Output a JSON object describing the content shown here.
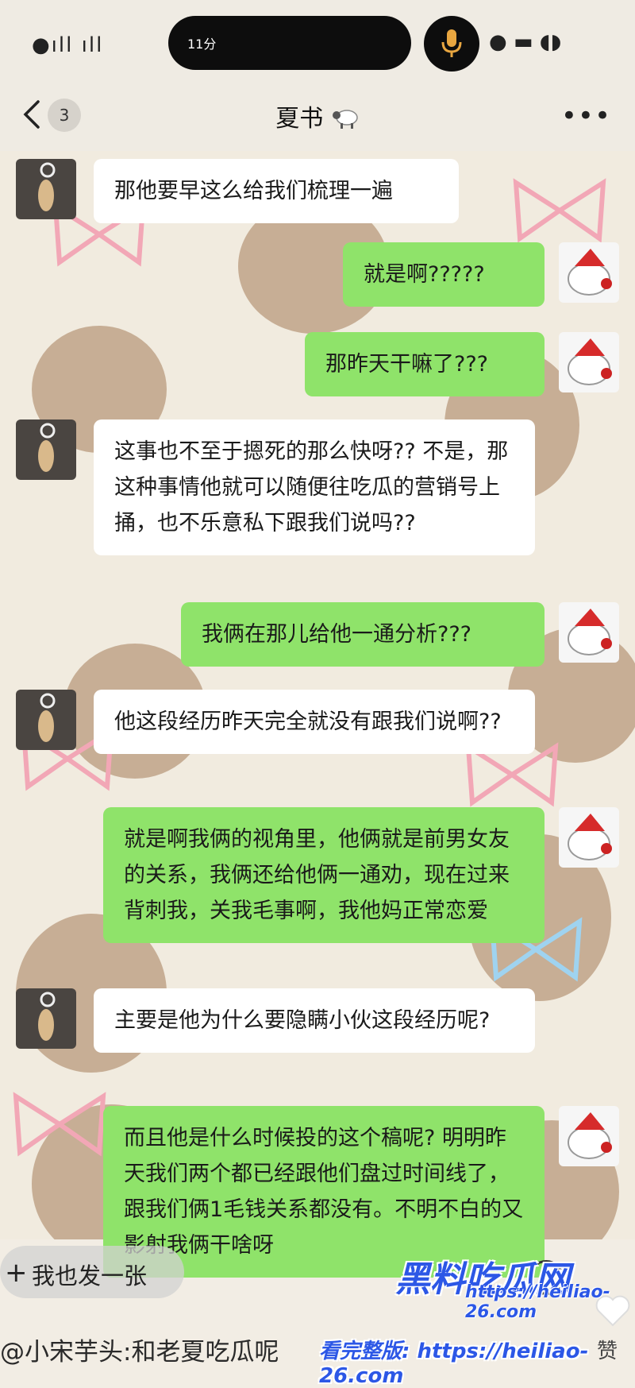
{
  "status_bar": {
    "time": "11分"
  },
  "header": {
    "unread_count": "3",
    "title": "夏书"
  },
  "messages": [
    {
      "side": "in",
      "text": "那他要早这么给我们梳理一遍"
    },
    {
      "side": "out",
      "text": "就是啊?????"
    },
    {
      "side": "out",
      "text": "那昨天干嘛了???"
    },
    {
      "side": "in",
      "text": "这事也不至于摁死的那么快呀?? 不是，那这种事情他就可以随便往吃瓜的营销号上捅，也不乐意私下跟我们说吗??"
    },
    {
      "side": "out",
      "text": "我俩在那儿给他一通分析???"
    },
    {
      "side": "in",
      "text": "他这段经历昨天完全就没有跟我们说啊??"
    },
    {
      "side": "out",
      "text": "就是啊我俩的视角里，他俩就是前男女友的关系，我俩还给他俩一通劝，现在过来背刺我，关我毛事啊，我他妈正常恋爱"
    },
    {
      "side": "in",
      "text": "主要是他为什么要隐瞒小伙这段经历呢?"
    },
    {
      "side": "out",
      "text": "而且他是什么时候投的这个稿呢? 明明昨天我们两个都已经跟他们盘过时间线了，跟我们俩1毛钱关系都没有。不明不白的又影射我俩干啥呀"
    }
  ],
  "bottom": {
    "share_label": "我也发一张",
    "caption": "@小宋芋头:和老夏吃瓜呢",
    "caption_tail": "瓜呢",
    "like_label": "赞"
  },
  "watermark": {
    "brand": "黑料吃瓜网",
    "url": "https://heiliao-26.com",
    "full_label": "看完整版: https://heiliao-26.com"
  },
  "colors": {
    "outgoing_bubble": "#8fe36a",
    "incoming_bubble": "#ffffff",
    "watermark": "#2c57e6"
  }
}
